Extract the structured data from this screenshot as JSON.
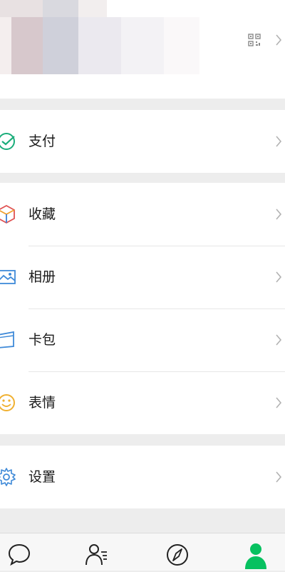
{
  "profile": {
    "qr_icon": "qr-code-icon",
    "chevron_icon": "chevron-right-icon"
  },
  "menu": {
    "pay": {
      "label": "支付",
      "icon": "pay-check-icon"
    },
    "favorites": {
      "label": "收藏",
      "icon": "favorites-cube-icon"
    },
    "album": {
      "label": "相册",
      "icon": "album-image-icon"
    },
    "cards": {
      "label": "卡包",
      "icon": "card-wallet-icon"
    },
    "stickers": {
      "label": "表情",
      "icon": "smiley-icon"
    },
    "settings": {
      "label": "设置",
      "icon": "gear-icon"
    }
  },
  "tabbar": {
    "tabs": [
      {
        "icon": "chat-bubble-icon"
      },
      {
        "icon": "contacts-icon"
      },
      {
        "icon": "compass-icon"
      },
      {
        "icon": "me-person-icon",
        "active": true
      }
    ]
  },
  "colors": {
    "accent": "#07c160",
    "background": "#ededed",
    "chevron": "#b2b2b2"
  }
}
